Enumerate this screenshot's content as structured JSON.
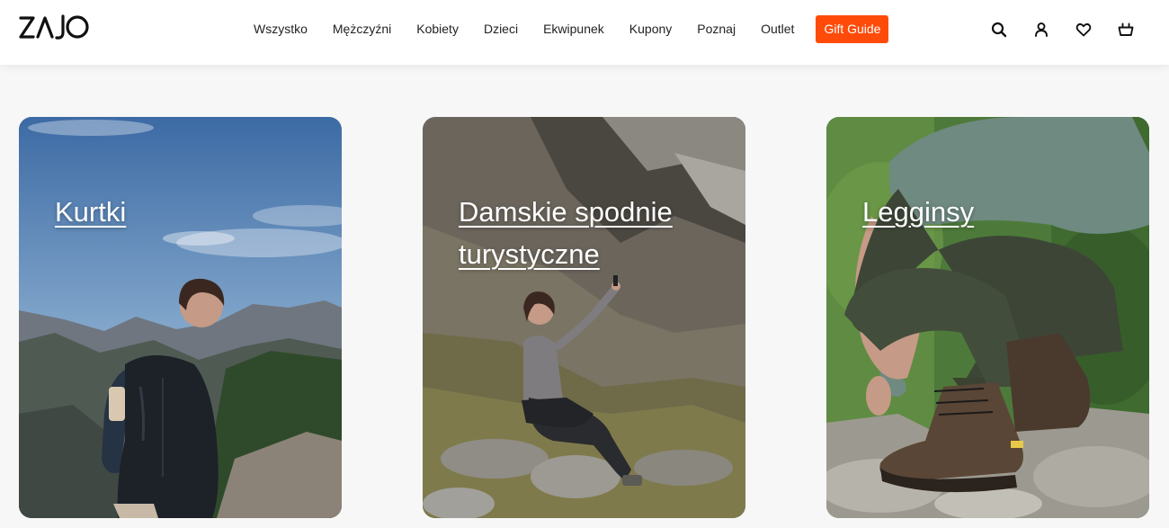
{
  "header": {
    "logo_text": "ZAJO",
    "nav": [
      "Wszystko",
      "Mężczyźni",
      "Kobiety",
      "Dzieci",
      "Ekwipunek",
      "Kupony",
      "Poznaj",
      "Outlet"
    ],
    "gift_guide": "Gift Guide",
    "icons": [
      "search-icon",
      "account-icon",
      "wishlist-heart-icon",
      "cart-basket-icon"
    ]
  },
  "cards": [
    {
      "title": "Kurtki"
    },
    {
      "title": "Damskie spodnie turystyczne"
    },
    {
      "title": "Legginsy"
    }
  ],
  "colors": {
    "accent": "#ff4b0a",
    "background": "#f7f7f7",
    "text": "#222222"
  }
}
